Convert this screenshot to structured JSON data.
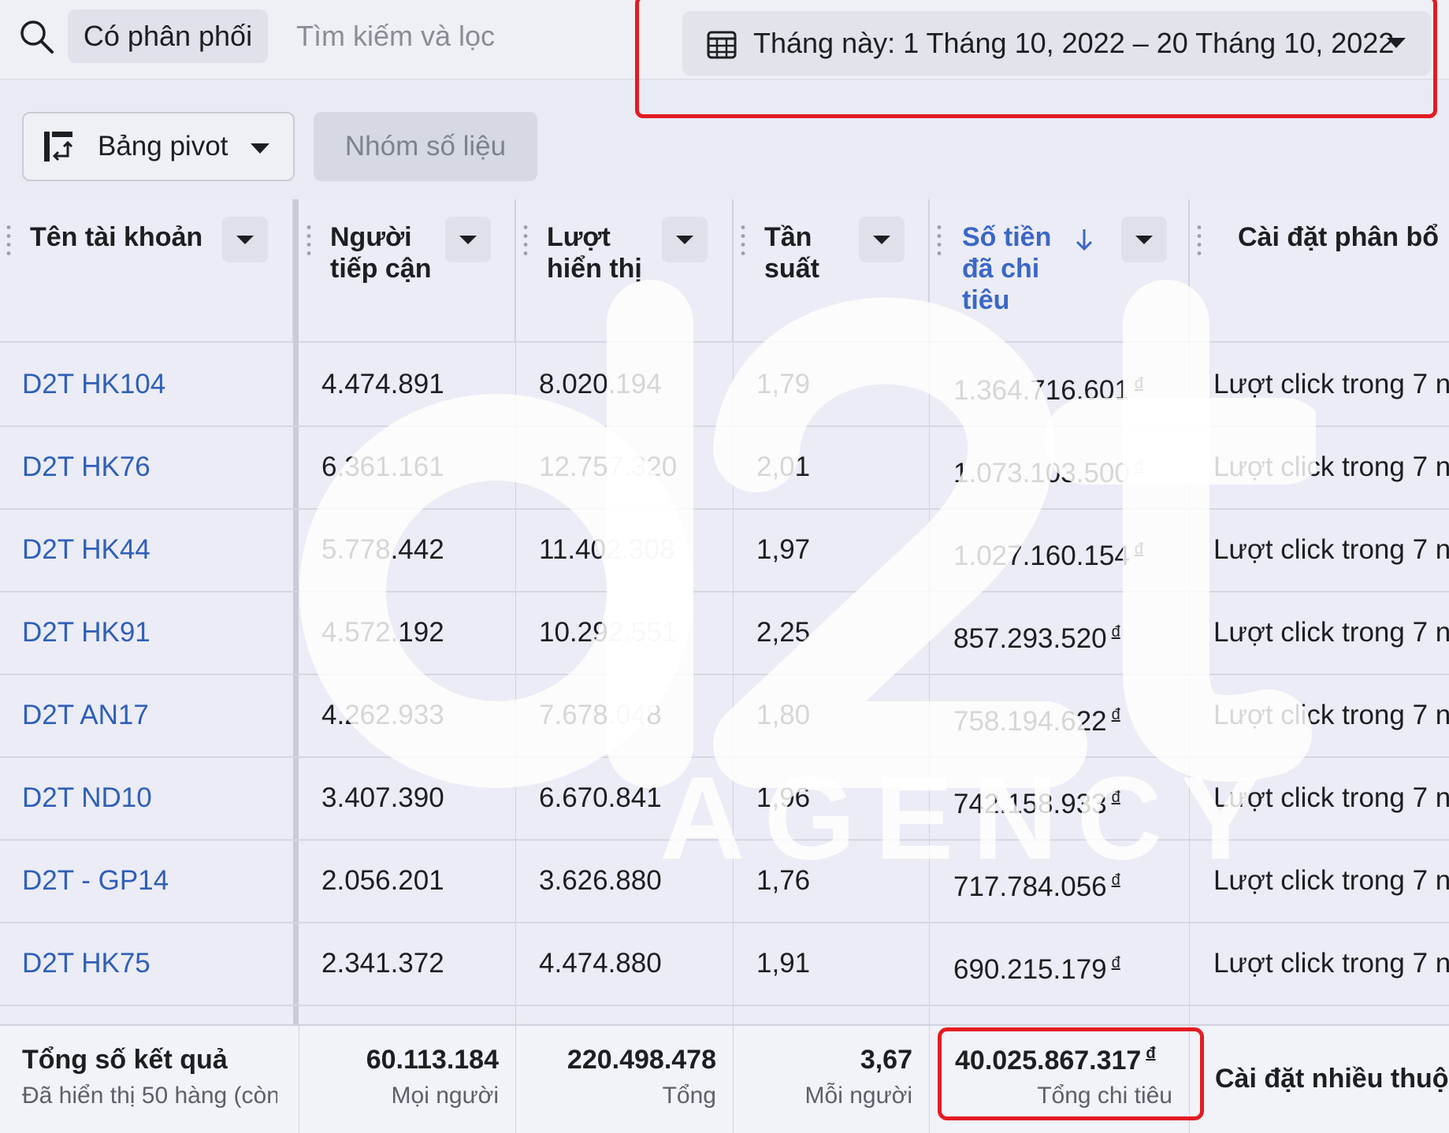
{
  "search": {
    "chip_label": "Có phân phối",
    "placeholder": "Tìm kiếm và lọc"
  },
  "date_range": {
    "label": "Tháng này: 1 Tháng 10, 2022 – 20 Tháng 10, 2022"
  },
  "toolbar": {
    "pivot_label": "Bảng pivot",
    "metric_group_label": "Nhóm số liệu"
  },
  "columns": {
    "account": "Tên tài khoản",
    "reach": "Người tiếp cận",
    "impressions": "Lượt hiển thị",
    "frequency": "Tần suất",
    "spend": "Số tiền đã chi tiêu",
    "attribution": "Cài đặt phân bổ"
  },
  "rows": [
    {
      "account": "D2T HK104",
      "reach": "4.474.891",
      "impressions": "8.020.194",
      "frequency": "1,79",
      "spend": "1.364.716.601",
      "attribution": "Lượt click trong 7 n"
    },
    {
      "account": "D2T HK76",
      "reach": "6.361.161",
      "impressions": "12.757.320",
      "frequency": "2,01",
      "spend": "1.073.103.500",
      "attribution": "Lượt click trong 7 n"
    },
    {
      "account": "D2T HK44",
      "reach": "5.778.442",
      "impressions": "11.402.308",
      "frequency": "1,97",
      "spend": "1.027.160.154",
      "attribution": "Lượt click trong 7 n"
    },
    {
      "account": "D2T HK91",
      "reach": "4.572.192",
      "impressions": "10.292.551",
      "frequency": "2,25",
      "spend": "857.293.520",
      "attribution": "Lượt click trong 7 n"
    },
    {
      "account": "D2T AN17",
      "reach": "4.262.933",
      "impressions": "7.678.048",
      "frequency": "1,80",
      "spend": "758.194.622",
      "attribution": "Lượt click trong 7 n"
    },
    {
      "account": "D2T ND10",
      "reach": "3.407.390",
      "impressions": "6.670.841",
      "frequency": "1,96",
      "spend": "742.158.933",
      "attribution": "Lượt click trong 7 n"
    },
    {
      "account": "D2T - GP14",
      "reach": "2.056.201",
      "impressions": "3.626.880",
      "frequency": "1,76",
      "spend": "717.784.056",
      "attribution": "Lượt click trong 7 n"
    },
    {
      "account": "D2T HK75",
      "reach": "2.341.372",
      "impressions": "4.474.880",
      "frequency": "1,91",
      "spend": "690.215.179",
      "attribution": "Lượt click trong 7 n"
    }
  ],
  "currency_symbol": "đ",
  "footer": {
    "title": "Tổng số kết quả",
    "subtitle": "Đã hiển thị 50 hàng (còn",
    "reach_total": "60.113.184",
    "reach_sub": "Mọi người",
    "impressions_total": "220.498.478",
    "impressions_sub": "Tổng",
    "frequency_total": "3,67",
    "frequency_sub": "Mỗi người",
    "spend_total": "40.025.867.317",
    "spend_sub": "Tổng chi tiêu",
    "attribution_total": "Cài đặt nhiều thuộc"
  },
  "watermark": {
    "logo": "d2t",
    "text": "AGENCY"
  },
  "colors": {
    "link_blue": "#2f5fb8",
    "highlight_red": "#e31b23"
  }
}
